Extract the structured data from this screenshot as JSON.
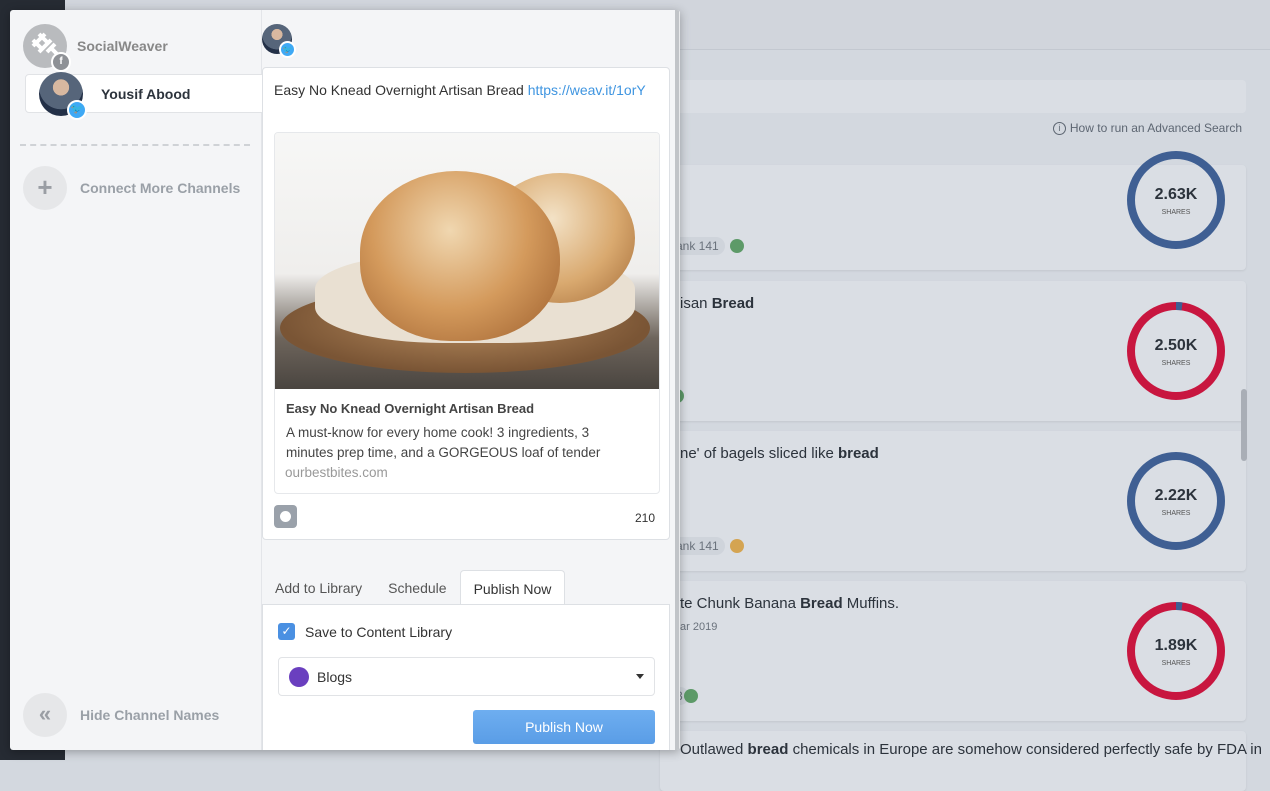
{
  "background": {
    "advanced_search_link": "How to run an Advanced Search",
    "results": [
      {
        "title_html": "",
        "rank": "ank 141",
        "dot_color": "#5d9a68",
        "shares": "2.63K",
        "shares_label": "SHARES",
        "ring": "blue"
      },
      {
        "title_html": "isan <b>Bread</b>",
        "rank": "",
        "dot_color": "#5d9a68",
        "shares": "2.50K",
        "shares_label": "SHARES",
        "ring": "red"
      },
      {
        "title_html": "ne' of bagels sliced like <b>bread</b>",
        "rank": "ank 141",
        "dot_color": "#d4a452",
        "shares": "2.22K",
        "shares_label": "SHARES",
        "ring": "blue"
      },
      {
        "title_html": "te Chunk Banana <b>Bread</b> Muffins.",
        "date": "ar 2019",
        "rank": "3",
        "dot_color": "#5d9a68",
        "shares": "1.89K",
        "shares_label": "SHARES",
        "ring": "red"
      },
      {
        "title_html": "Outlawed <b>bread</b> chemicals in Europe are somehow considered perfectly safe by FDA in"
      }
    ]
  },
  "sidebar": {
    "channels": [
      {
        "name": "SocialWeaver",
        "network": "facebook",
        "badge": "f",
        "selected": false
      },
      {
        "name": "Yousif Abood",
        "network": "twitter",
        "badge": "t",
        "selected": true
      }
    ],
    "connect_more": "Connect More Channels",
    "hide_names": "Hide Channel Names"
  },
  "composer": {
    "text": "Easy No Knead Overnight Artisan Bread ",
    "url": "https://weav.it/1orY",
    "preview": {
      "title": "Easy No Knead Overnight Artisan Bread",
      "description": "A must-know for every home cook! 3 ingredients, 3 minutes prep time, and a GORGEOUS loaf of tender",
      "domain": "ourbestbites.com"
    },
    "char_count": "210"
  },
  "tabs": [
    {
      "label": "Add to Library"
    },
    {
      "label": "Schedule"
    },
    {
      "label": "Publish Now",
      "active": true
    }
  ],
  "publish": {
    "save_label": "Save to Content Library",
    "save_checked": true,
    "library_select": "Blogs",
    "library_color": "#6a3fbf",
    "button": "Publish Now"
  },
  "colors": {
    "accent": "#4a90e2",
    "twitter": "#3fa9f5",
    "ring_blue": "#3f5f93",
    "ring_red": "#c8163f"
  }
}
